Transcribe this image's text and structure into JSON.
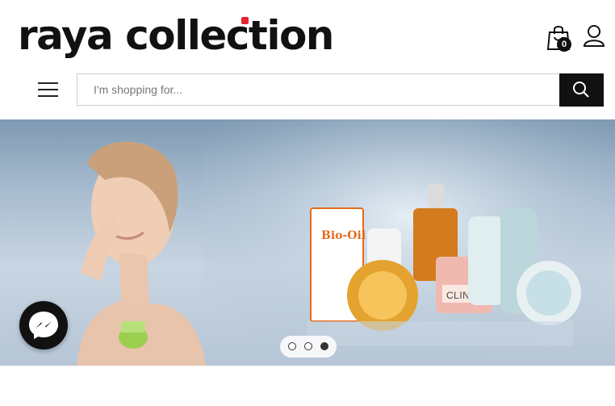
{
  "brand": {
    "logo_text": "raya collection",
    "accent_color": "#e3262e"
  },
  "header": {
    "cart_icon": "shopping-bag-icon",
    "cart_count": "0",
    "account_icon": "user-icon",
    "menu_icon": "hamburger-icon"
  },
  "search": {
    "placeholder": "I'm shopping for...",
    "value": "",
    "button_icon": "search-icon"
  },
  "banner": {
    "slides_total": 3,
    "active_slide": 3,
    "product_labels": [
      "Bio-Oil",
      "CLINIQUE"
    ]
  },
  "chat": {
    "icon": "messenger-icon"
  },
  "colors": {
    "primary_dark": "#111111",
    "banner_bg": "#a9bdd0"
  }
}
